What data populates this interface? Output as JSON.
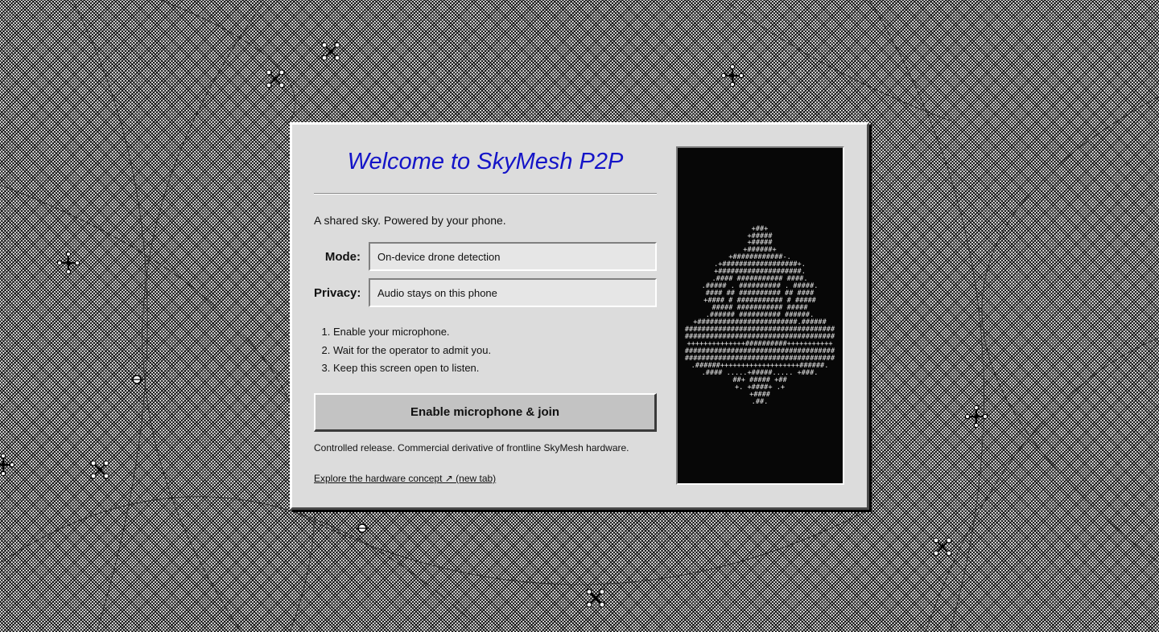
{
  "welcome": {
    "title": "Welcome to SkyMesh P2P",
    "tagline": "A shared sky. Powered by your phone."
  },
  "fields": {
    "mode_label": "Mode:",
    "mode_value": "On-device drone detection",
    "privacy_label": "Privacy:",
    "privacy_value": "Audio stays on this phone"
  },
  "steps": [
    "Enable your microphone.",
    "Wait for the operator to admit you.",
    "Keep this screen open to listen."
  ],
  "join_button_label": "Enable microphone & join",
  "release_note": "Controlled release. Commercial derivative of frontline SkyMesh hardware.",
  "hardware_link": "Explore the hardware concept ↗ (new tab)",
  "icons": {
    "background": "drone-icon",
    "art": "ascii-drone-art"
  },
  "colors": {
    "title": "#1414c8",
    "panel": "#dcdcdc",
    "art_background": "#070707"
  }
}
